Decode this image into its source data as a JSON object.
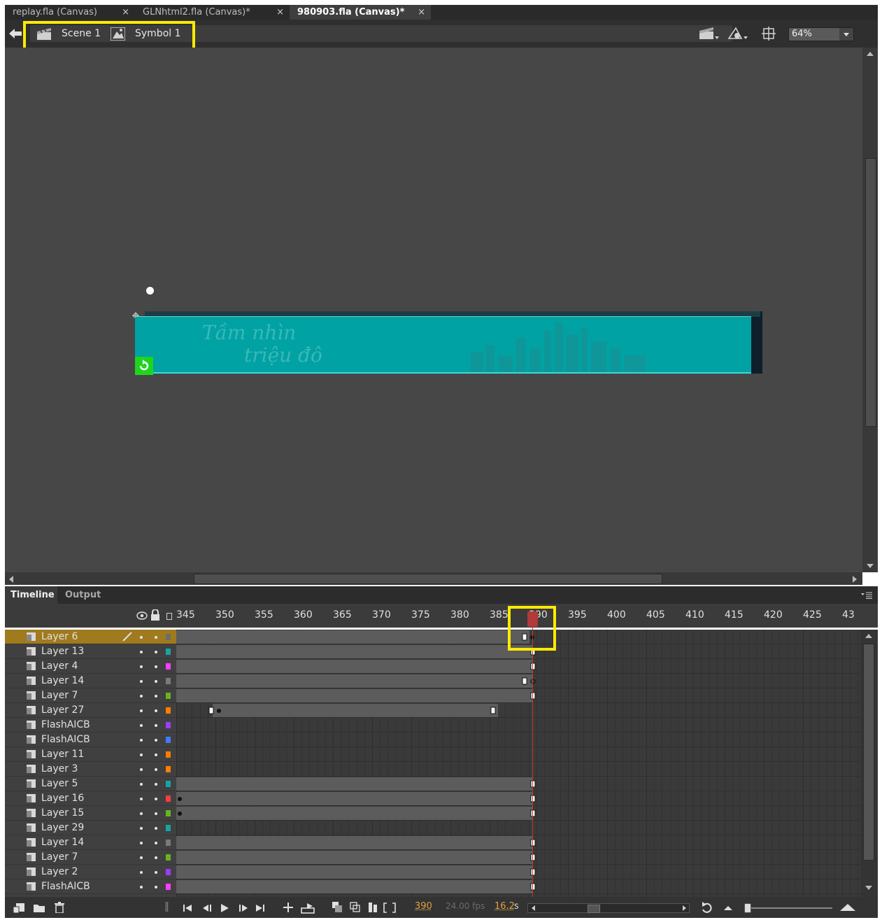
{
  "tabs": [
    {
      "label": "replay.fla (Canvas)",
      "close": "×"
    },
    {
      "label": "GLNhtml2.fla (Canvas)*",
      "close": "×"
    },
    {
      "label": "980903.fla (Canvas)*",
      "close": "×"
    }
  ],
  "breadcrumb": {
    "scene": "Scene 1",
    "symbol": "Symbol 1"
  },
  "zoom": "64%",
  "stage": {
    "banner_text_line1": "Tầm nhìn",
    "banner_text_line2": "triệu đô",
    "banner_color": "#00a2a3"
  },
  "panel_tabs": {
    "timeline": "Timeline",
    "output": "Output"
  },
  "frame_ticks": [
    "345",
    "350",
    "355",
    "360",
    "365",
    "370",
    "375",
    "380",
    "385",
    "390",
    "395",
    "400",
    "405",
    "410",
    "415",
    "420",
    "425",
    "43"
  ],
  "layers": [
    {
      "name": "Layer 6",
      "color": "#6d6d6d",
      "selected": true
    },
    {
      "name": "Layer 13",
      "color": "#1aa3a3"
    },
    {
      "name": "Layer 4",
      "color": "#ff3dff"
    },
    {
      "name": "Layer 14",
      "color": "#7a7a7a"
    },
    {
      "name": "Layer 7",
      "color": "#6bb21f"
    },
    {
      "name": "Layer 27",
      "color": "#ff7d00"
    },
    {
      "name": "FlashAICB",
      "color": "#9b3dff"
    },
    {
      "name": "FlashAICB",
      "color": "#3d7dff"
    },
    {
      "name": "Layer 11",
      "color": "#ff7d00"
    },
    {
      "name": "Layer 3",
      "color": "#ff7d00"
    },
    {
      "name": "Layer 5",
      "color": "#1aa3a3"
    },
    {
      "name": "Layer 16",
      "color": "#ff3d3d"
    },
    {
      "name": "Layer 15",
      "color": "#6bb21f"
    },
    {
      "name": "Layer 29",
      "color": "#1aa3a3"
    },
    {
      "name": "Layer 14",
      "color": "#7a7a7a"
    },
    {
      "name": "Layer 7",
      "color": "#6bb21f"
    },
    {
      "name": "Layer 2",
      "color": "#9b3dff"
    },
    {
      "name": "FlashAICB",
      "color": "#ff3dff"
    }
  ],
  "status": {
    "current_frame": "390",
    "fps": "24.00 fps",
    "elapsed": "16.2",
    "elapsed_unit": "s"
  },
  "colors": {
    "highlight": "#ffea00",
    "playhead": "#c0392b"
  }
}
